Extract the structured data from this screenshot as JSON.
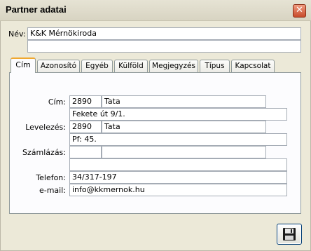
{
  "window": {
    "title": "Partner adatai",
    "close_glyph": "✕"
  },
  "name": {
    "label": "Név:",
    "value": "K&K Mérnökiroda",
    "value2": ""
  },
  "tabs": [
    {
      "label": "Cím",
      "active": true
    },
    {
      "label": "Azonosító"
    },
    {
      "label": "Egyéb"
    },
    {
      "label": "Külföld"
    },
    {
      "label": "Megjegyzés"
    },
    {
      "label": "Típus"
    },
    {
      "label": "Kapcsolat"
    }
  ],
  "address": {
    "cim": {
      "label": "Cím:",
      "zip": "2890",
      "city": "Tata",
      "street": "Fekete út 9/1."
    },
    "levelezes": {
      "label": "Levelezés:",
      "zip": "2890",
      "city": "Tata",
      "street": "Pf: 45."
    },
    "szamlazas": {
      "label": "Számlázás:",
      "zip": "",
      "city": "",
      "street": ""
    },
    "telefon": {
      "label": "Telefon:",
      "value": "34/317-197"
    },
    "email": {
      "label": "e-mail:",
      "value": "info@kkmernok.hu"
    }
  },
  "toolbar": {
    "save_icon": "floppy-disk-icon"
  },
  "colors": {
    "accent_tab": "#f0a830",
    "window_bg": "#ece9d8",
    "close_button": "#d9603f"
  }
}
